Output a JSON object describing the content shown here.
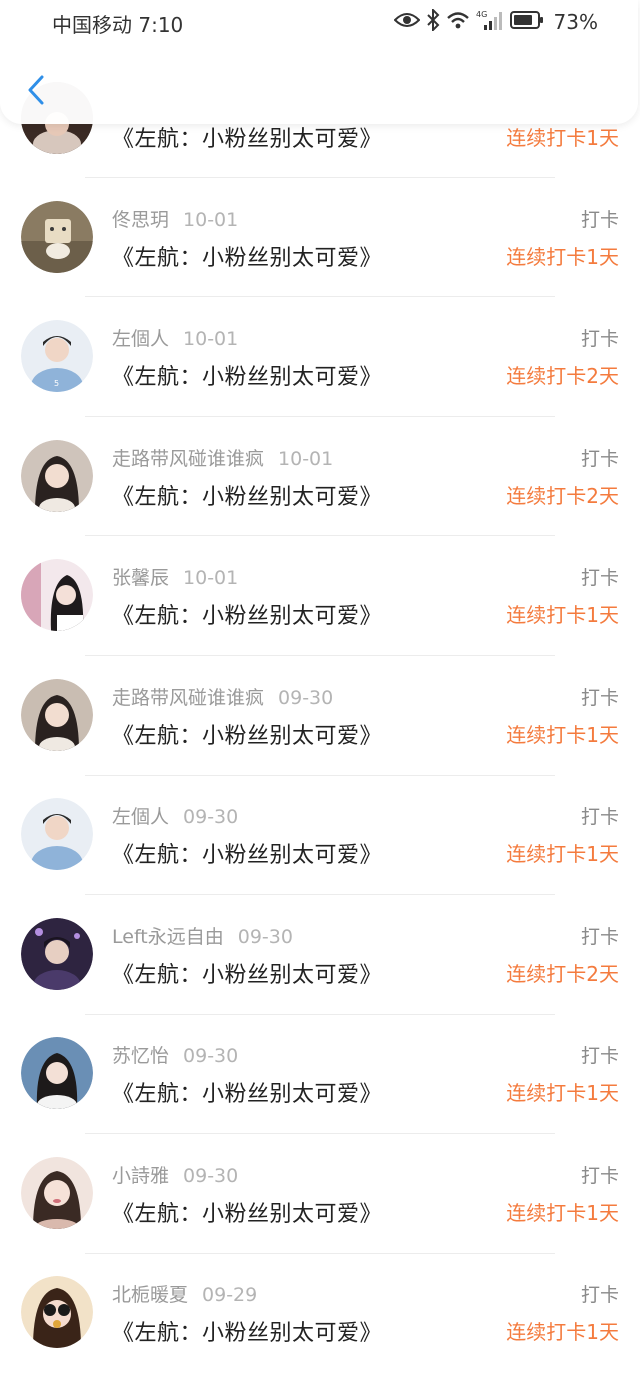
{
  "status_bar": {
    "carrier_time": "中国移动 7:10",
    "network": "4G",
    "battery": "73%"
  },
  "entries": [
    {
      "user": "",
      "date": "",
      "action": "",
      "title": "《左航：小粉丝别太可爱》",
      "streak": "连续打卡1天"
    },
    {
      "user": "佟思玥",
      "date": "10-01",
      "action": "打卡",
      "title": "《左航：小粉丝别太可爱》",
      "streak": "连续打卡1天"
    },
    {
      "user": "左個人",
      "date": "10-01",
      "action": "打卡",
      "title": "《左航：小粉丝别太可爱》",
      "streak": "连续打卡2天"
    },
    {
      "user": "走路带风碰谁谁疯",
      "date": "10-01",
      "action": "打卡",
      "title": "《左航：小粉丝别太可爱》",
      "streak": "连续打卡2天"
    },
    {
      "user": "张馨辰",
      "date": "10-01",
      "action": "打卡",
      "title": "《左航：小粉丝别太可爱》",
      "streak": "连续打卡1天"
    },
    {
      "user": "走路带风碰谁谁疯",
      "date": "09-30",
      "action": "打卡",
      "title": "《左航：小粉丝别太可爱》",
      "streak": "连续打卡1天"
    },
    {
      "user": "左個人",
      "date": "09-30",
      "action": "打卡",
      "title": "《左航：小粉丝别太可爱》",
      "streak": "连续打卡1天"
    },
    {
      "user": "Left永远自由",
      "date": "09-30",
      "action": "打卡",
      "title": "《左航：小粉丝别太可爱》",
      "streak": "连续打卡2天"
    },
    {
      "user": "苏忆怡",
      "date": "09-30",
      "action": "打卡",
      "title": "《左航：小粉丝别太可爱》",
      "streak": "连续打卡1天"
    },
    {
      "user": "小詩雅",
      "date": "09-30",
      "action": "打卡",
      "title": "《左航：小粉丝别太可爱》",
      "streak": "连续打卡1天"
    },
    {
      "user": "北栀暖夏",
      "date": "09-29",
      "action": "打卡",
      "title": "《左航：小粉丝别太可爱》",
      "streak": "连续打卡1天"
    }
  ],
  "colors": {
    "streak": "#f47b3e",
    "back_arrow": "#2f8fe8",
    "avatars": [
      "#3a2a24",
      "#8a7b62",
      "#8fb3d9",
      "#cfc4bb",
      "#d8a6b8",
      "#c9bdb2",
      "#8fb3d9",
      "#4a3a6a",
      "#6a8fb5",
      "#d9b9ad",
      "#e0a63a"
    ]
  }
}
